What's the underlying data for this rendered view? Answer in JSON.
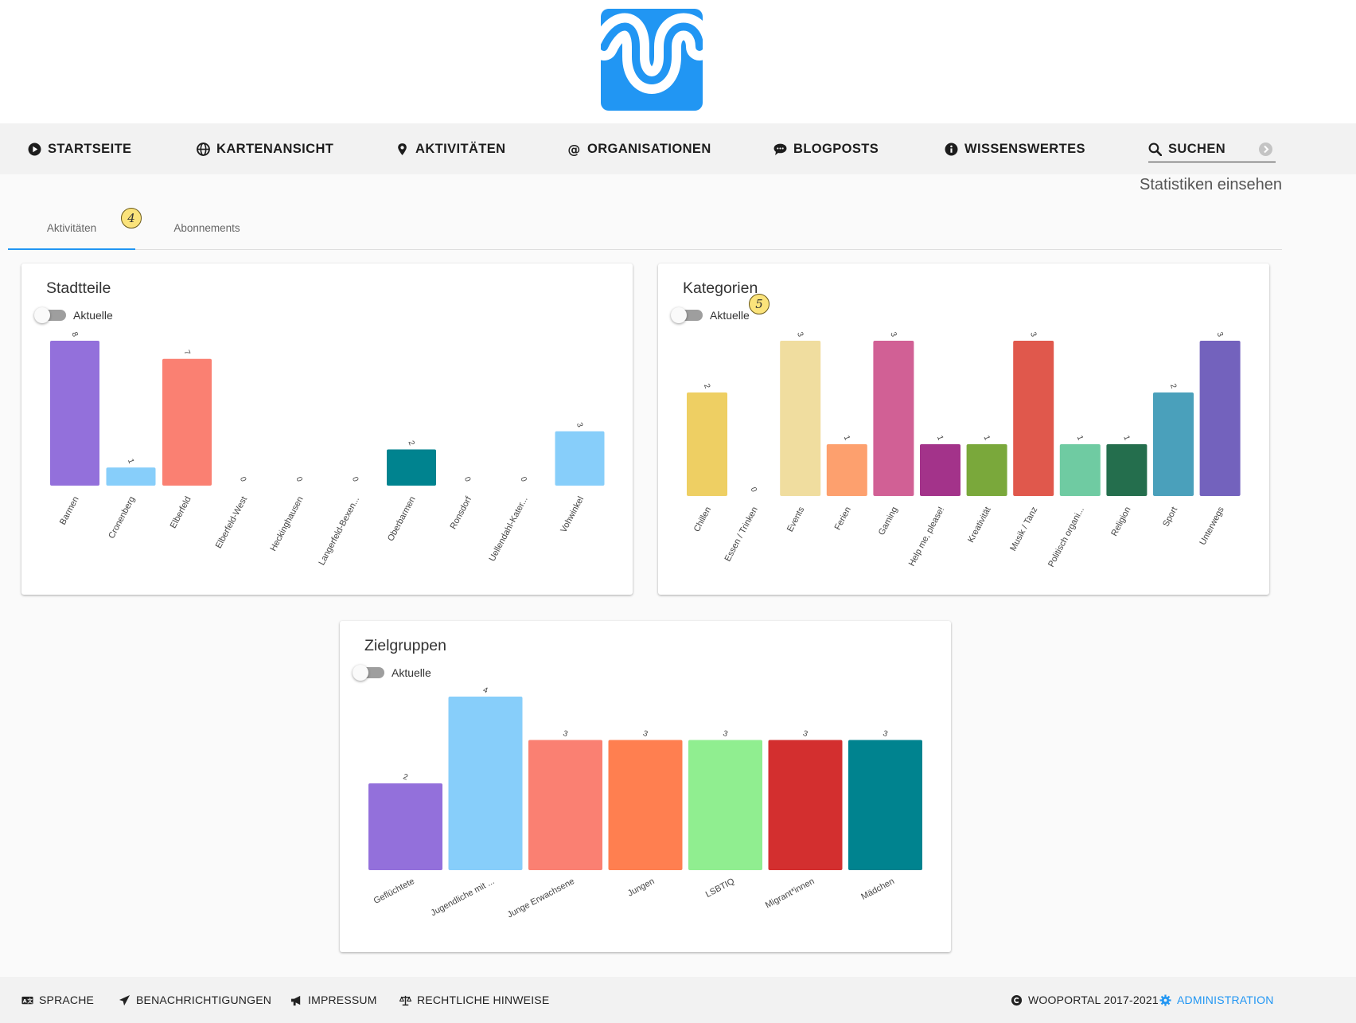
{
  "logo": {
    "name": "wooportal-logo",
    "color": "#2196f3"
  },
  "nav": {
    "items": [
      {
        "label": "STARTSEITE",
        "icon": "play-circle-icon"
      },
      {
        "label": "KARTENANSICHT",
        "icon": "globe-icon"
      },
      {
        "label": "AKTIVITÄTEN",
        "icon": "map-pin-icon"
      },
      {
        "label": "ORGANISATIONEN",
        "icon": "at-icon"
      },
      {
        "label": "BLOGPOSTS",
        "icon": "chat-bubble-icon"
      },
      {
        "label": "WISSENSWERTES",
        "icon": "info-icon"
      }
    ],
    "search": {
      "label": "SUCHEN",
      "icon": "search-icon",
      "clear_icon": "clear-icon"
    }
  },
  "page": {
    "heading": "Statistiken einsehen"
  },
  "tabs": {
    "active": "Aktivitäten",
    "items": [
      "Aktivitäten",
      "Abonnements"
    ]
  },
  "badges": [
    "4",
    "5"
  ],
  "toggle_label": "Aktuelle",
  "chart_data": [
    {
      "id": "stadtteile",
      "type": "bar",
      "title": "Stadtteile",
      "categories": [
        "Barmen",
        "Cronenberg",
        "Elberfeld",
        "Elberfeld-West",
        "Heckinghausen",
        "Langerfeld-Bexen...",
        "Oberbarmen",
        "Ronsdorf",
        "Uellendahl-Kater...",
        "Vohwinkel"
      ],
      "values": [
        8,
        1,
        7,
        0,
        0,
        0,
        2,
        0,
        0,
        3
      ],
      "colors": [
        "#9370db",
        "#87cefa",
        "#fa8072",
        "#ff7f50",
        "#90ee90",
        "#d32f2f",
        "#00838f",
        "#87cefa",
        "#fa8072",
        "#87cefa"
      ],
      "ylim": [
        0,
        8
      ]
    },
    {
      "id": "kategorien",
      "type": "bar",
      "title": "Kategorien",
      "categories": [
        "Chillen",
        "Essen / Trinken",
        "Events",
        "Ferien",
        "Gaming",
        "Help me, please!",
        "Kreativität",
        "Musik / Tanz",
        "Politisch organi...",
        "Religion",
        "Sport",
        "Unterwegs"
      ],
      "values": [
        2,
        0,
        3,
        1,
        3,
        1,
        1,
        3,
        1,
        1,
        2,
        3
      ],
      "colors": [
        "#eecf63",
        "#f0a35e",
        "#f0dd9f",
        "#fda06e",
        "#d16095",
        "#a3338a",
        "#7aa83b",
        "#e0584c",
        "#6fcba2",
        "#246e4d",
        "#4aa0bb",
        "#7362bd"
      ],
      "ylim": [
        0,
        3
      ]
    },
    {
      "id": "zielgruppen",
      "type": "bar",
      "title": "Zielgruppen",
      "categories": [
        "Geflüchtete",
        "Jugendliche mit ...",
        "Junge Erwachsene",
        "Jungen",
        "LSBTIQ",
        "Migrant*innen",
        "Mädchen"
      ],
      "values": [
        2,
        4,
        3,
        3,
        3,
        3,
        3
      ],
      "colors": [
        "#9370db",
        "#87cefa",
        "#fa8072",
        "#ff7f50",
        "#90ee90",
        "#d32f2f",
        "#00838f"
      ],
      "ylim": [
        0,
        4
      ]
    }
  ],
  "footer": {
    "left": [
      {
        "label": "SPRACHE",
        "icon": "language-icon"
      },
      {
        "label": "BENACHRICHTIGUNGEN",
        "icon": "paper-plane-icon"
      },
      {
        "label": "IMPRESSUM",
        "icon": "megaphone-icon"
      },
      {
        "label": "RECHTLICHE HINWEISE",
        "icon": "scale-icon"
      }
    ],
    "copyright": {
      "label": "WOOPORTAL 2017-2021",
      "icon": "copyright-icon"
    },
    "admin": {
      "label": "ADMINISTRATION",
      "icon": "gear-icon",
      "color": "#2196f3"
    }
  }
}
